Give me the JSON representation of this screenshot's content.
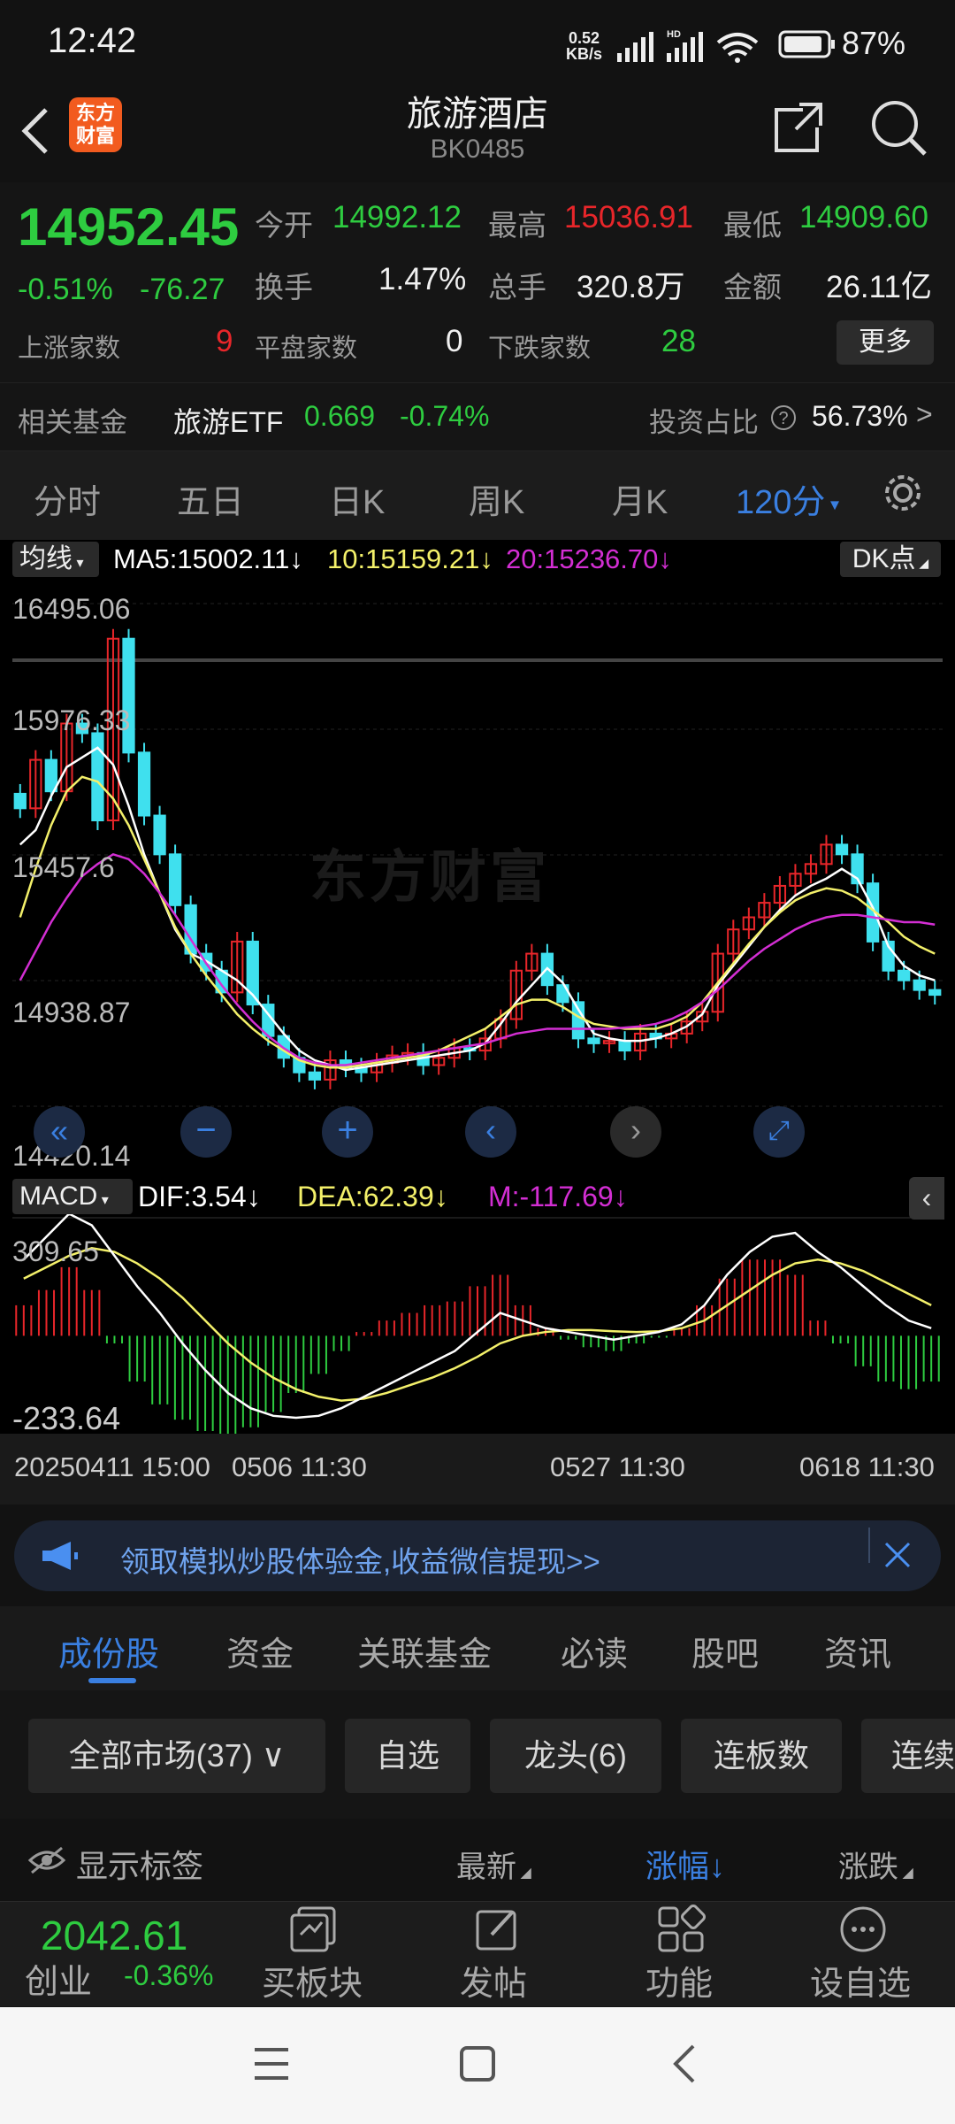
{
  "status": {
    "time": "12:42",
    "net_speed_top": "0.52",
    "net_speed_bottom": "KB/s",
    "battery": "87%"
  },
  "header": {
    "logo_line1": "东方",
    "logo_line2": "财富",
    "title": "旅游酒店",
    "code": "BK0485"
  },
  "quote": {
    "price": "14952.45",
    "change_pct": "-0.51%",
    "change": "-76.27",
    "open_label": "今开",
    "open": "14992.12",
    "high_label": "最高",
    "high": "15036.91",
    "low_label": "最低",
    "low": "14909.60",
    "turnover_label": "换手",
    "turnover": "1.47%",
    "volume_label": "总手",
    "volume": "320.8万",
    "amount_label": "金额",
    "amount": "26.11亿",
    "up_label": "上涨家数",
    "up": "9",
    "flat_label": "平盘家数",
    "flat": "0",
    "down_label": "下跌家数",
    "down": "28",
    "more": "更多"
  },
  "fund": {
    "label": "相关基金",
    "name": "旅游ETF",
    "price": "0.669",
    "change": "-0.74%",
    "ratio_label": "投资占比",
    "ratio": "56.73%"
  },
  "ktabs": [
    "分时",
    "五日",
    "日K",
    "周K",
    "月K",
    "120分"
  ],
  "chart_header": {
    "ma_btn": "均线",
    "ma5": "MA5:15002.11",
    "ma10": "10:15159.21",
    "ma20": "20:15236.70",
    "dk": "DK点"
  },
  "macd_header": {
    "btn": "MACD",
    "dif": "DIF:3.54",
    "dea": "DEA:62.39",
    "m": "M:-117.69"
  },
  "x_labels": [
    "20250411 15:00",
    "0506 11:30",
    "0527 11:30",
    "0618 11:30"
  ],
  "watermark": "东方财富",
  "ad": {
    "text": "领取模拟炒股体验金,收益微信提现>>"
  },
  "btabs": [
    "成份股",
    "资金",
    "关联基金",
    "必读",
    "股吧",
    "资讯"
  ],
  "filters": [
    "全部市场(37)",
    "自选",
    "龙头(6)",
    "连板数",
    "连续"
  ],
  "list_header": {
    "show_tags": "显示标签",
    "latest": "最新",
    "change_pct": "涨幅",
    "change": "涨跌"
  },
  "bottom": {
    "index_value": "2042.61",
    "index_name": "创业",
    "index_change": "-0.36%",
    "buy": "买板块",
    "post": "发帖",
    "func": "功能",
    "watch": "设自选"
  },
  "colors": {
    "up": "#e8262a",
    "down": "#2ecc40",
    "accent": "#3a7fe0",
    "ma5": "#ffffff",
    "ma10": "#f3f06a",
    "ma20": "#d32ed3",
    "candle_down": "#3fe0ee"
  },
  "chart_data": [
    {
      "type": "candlestick",
      "yticks": [
        16495.06,
        15976.33,
        15457.6,
        14938.87,
        14420.14
      ],
      "ylim": [
        14420.14,
        16495.06
      ],
      "close": [
        15650,
        15850,
        15720,
        16000,
        15960,
        15600,
        16350,
        15880,
        15620,
        15460,
        15250,
        15050,
        14980,
        14890,
        15100,
        14840,
        14710,
        14620,
        14560,
        14530,
        14610,
        14580,
        14560,
        14600,
        14630,
        14640,
        14590,
        14620,
        14660,
        14650,
        14700,
        14780,
        14980,
        15050,
        14920,
        14850,
        14700,
        14680,
        14690,
        14650,
        14720,
        14700,
        14720,
        14770,
        14810,
        15050,
        15150,
        15200,
        15260,
        15330,
        15380,
        15420,
        15500,
        15460,
        15340,
        15100,
        14980,
        14940,
        14900,
        14880
      ],
      "ma_series": [
        {
          "name": "MA5",
          "values": [
            15500,
            15560,
            15700,
            15820,
            15860,
            15900,
            15830,
            15660,
            15460,
            15300,
            15150,
            15050,
            15020,
            14980,
            14940,
            14880,
            14800,
            14720,
            14650,
            14610,
            14590,
            14570,
            14580,
            14590,
            14600,
            14610,
            14620,
            14630,
            14640,
            14650,
            14680,
            14760,
            14850,
            14920,
            14990,
            14930,
            14820,
            14720,
            14700,
            14690,
            14690,
            14700,
            14720,
            14750,
            14800,
            14920,
            15000,
            15080,
            15160,
            15230,
            15290,
            15330,
            15360,
            15400,
            15360,
            15240,
            15080,
            15000,
            14960,
            14940
          ]
        },
        {
          "name": "MA10",
          "values": [
            15200,
            15400,
            15580,
            15720,
            15780,
            15760,
            15690,
            15580,
            15440,
            15300,
            15160,
            15050,
            14960,
            14880,
            14800,
            14740,
            14690,
            14650,
            14610,
            14590,
            14580,
            14580,
            14590,
            14600,
            14610,
            14620,
            14630,
            14650,
            14680,
            14710,
            14740,
            14790,
            14840,
            14860,
            14860,
            14830,
            14790,
            14760,
            14750,
            14740,
            14740,
            14740,
            14760,
            14790,
            14850,
            14930,
            15010,
            15090,
            15160,
            15220,
            15270,
            15300,
            15320,
            15310,
            15280,
            15230,
            15180,
            15120,
            15080,
            15050
          ]
        },
        {
          "name": "MA20",
          "values": [
            14940,
            15060,
            15180,
            15280,
            15370,
            15420,
            15460,
            15440,
            15380,
            15300,
            15210,
            15110,
            15010,
            14920,
            14840,
            14770,
            14710,
            14660,
            14620,
            14600,
            14590,
            14590,
            14600,
            14610,
            14620,
            14630,
            14640,
            14650,
            14660,
            14670,
            14680,
            14700,
            14720,
            14730,
            14740,
            14740,
            14740,
            14740,
            14740,
            14745,
            14750,
            14760,
            14780,
            14810,
            14850,
            14900,
            14960,
            15020,
            15070,
            15110,
            15150,
            15180,
            15200,
            15210,
            15210,
            15200,
            15190,
            15180,
            15180,
            15170
          ]
        }
      ]
    },
    {
      "type": "macd",
      "yticks": [
        309.65,
        -233.64
      ],
      "ylim": [
        -233.64,
        309.65
      ],
      "dif": [
        200,
        260,
        320,
        290,
        210,
        130,
        60,
        -20,
        -90,
        -150,
        -190,
        -210,
        -215,
        -210,
        -190,
        -160,
        -130,
        -100,
        -70,
        -40,
        10,
        60,
        40,
        20,
        10,
        0,
        -10,
        0,
        10,
        30,
        80,
        160,
        220,
        260,
        270,
        220,
        180,
        130,
        80,
        40,
        20
      ],
      "dea": [
        150,
        180,
        210,
        230,
        220,
        190,
        150,
        100,
        40,
        -20,
        -70,
        -110,
        -140,
        -160,
        -170,
        -165,
        -150,
        -130,
        -110,
        -85,
        -55,
        -20,
        0,
        10,
        15,
        15,
        12,
        10,
        12,
        20,
        40,
        80,
        120,
        160,
        190,
        200,
        190,
        170,
        140,
        110,
        80
      ],
      "macd": [
        80,
        120,
        180,
        120,
        -20,
        -120,
        -180,
        -220,
        -250,
        -260,
        -240,
        -200,
        -150,
        -100,
        -40,
        10,
        40,
        60,
        80,
        90,
        130,
        160,
        80,
        20,
        -10,
        -30,
        -40,
        -20,
        -5,
        20,
        80,
        150,
        200,
        200,
        160,
        40,
        -20,
        -80,
        -120,
        -140,
        -120
      ]
    }
  ]
}
